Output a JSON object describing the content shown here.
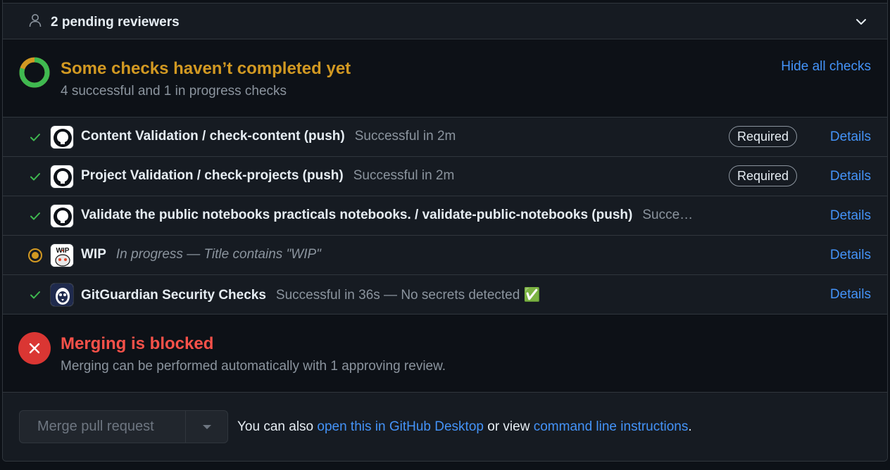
{
  "reviewers": {
    "label": "2 pending reviewers"
  },
  "checks": {
    "title": "Some checks haven’t completed yet",
    "subtitle": "4 successful and 1 in progress checks",
    "hide_label": "Hide all checks",
    "progress_fraction": 0.8,
    "rows": [
      {
        "status": "success",
        "icon": "github-icon",
        "name": "Content Validation / check-content (push)",
        "desc": "Successful in 2m",
        "required": "Required",
        "details": "Details"
      },
      {
        "status": "success",
        "icon": "github-icon",
        "name": "Project Validation / check-projects (push)",
        "desc": "Successful in 2m",
        "required": "Required",
        "details": "Details"
      },
      {
        "status": "success",
        "icon": "github-icon",
        "name": "Validate the public notebooks practicals notebooks. / validate-public-notebooks (push)",
        "desc": "Succe…",
        "required": "",
        "details": "Details"
      },
      {
        "status": "in-progress",
        "icon": "wip-app-icon",
        "name": "WIP",
        "desc": "In progress — Title contains \"WIP\"",
        "required": "",
        "details": "Details"
      },
      {
        "status": "success",
        "icon": "gitguardian-icon",
        "name": "GitGuardian Security Checks",
        "desc": "Successful in 36s — No secrets detected ✅",
        "required": "",
        "details": "Details"
      }
    ]
  },
  "blocked": {
    "title": "Merging is blocked",
    "subtitle": "Merging can be performed automatically with 1 approving review."
  },
  "merge": {
    "button_label": "Merge pull request",
    "text_prefix": "You can also ",
    "desktop_link": "open this in GitHub Desktop",
    "text_middle": " or view ",
    "cli_link": "command line instructions",
    "text_suffix": "."
  },
  "colors": {
    "success": "#3fb950",
    "pending": "#d29922",
    "danger": "#da3633",
    "link": "#4493f8"
  }
}
